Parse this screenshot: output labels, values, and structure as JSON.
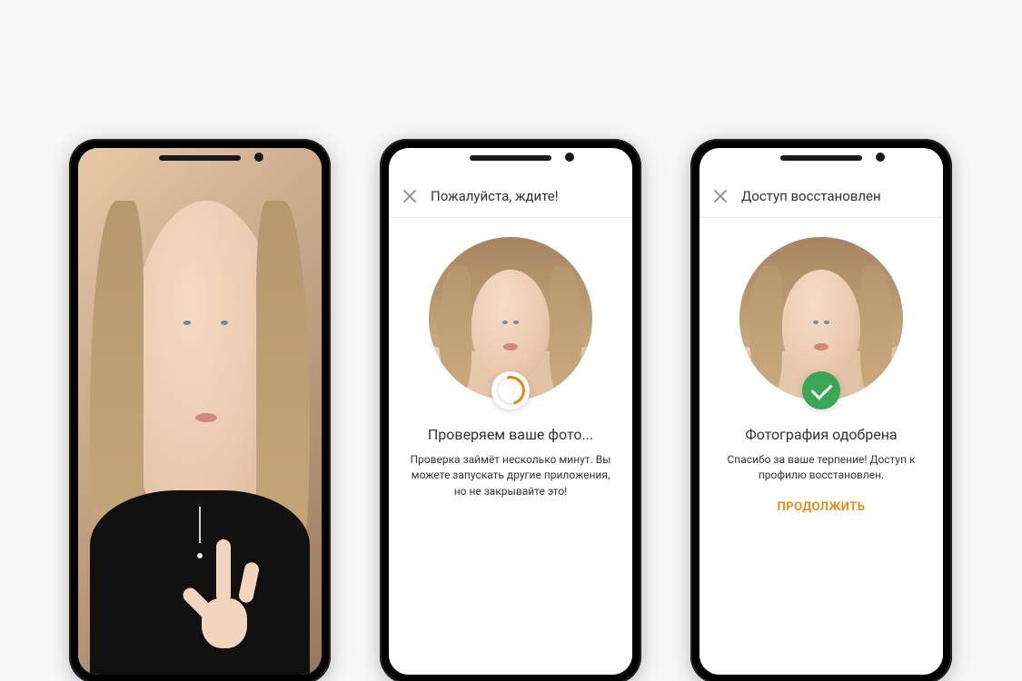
{
  "colors": {
    "accent": "#ee8208",
    "success": "#3aa757"
  },
  "phone1": {
    "description": "selfie-with-hand-gesture"
  },
  "phone2": {
    "appbar": {
      "close_icon": "close-icon",
      "title": "Пожалуйста, ждите!"
    },
    "status_icon": "spinner-loading-icon",
    "heading": "Проверяем ваше фото...",
    "subtext": "Проверка займёт несколько минут. Вы можете запускать другие приложения, но не закрывайте это!"
  },
  "phone3": {
    "appbar": {
      "close_icon": "close-icon",
      "title": "Доступ восстановлен"
    },
    "status_icon": "success-check-icon",
    "heading": "Фотография одобрена",
    "subtext": "Спасибо за ваше терпение! Доступ к профилю восстановлен.",
    "cta": "ПРОДОЛЖИТЬ"
  }
}
